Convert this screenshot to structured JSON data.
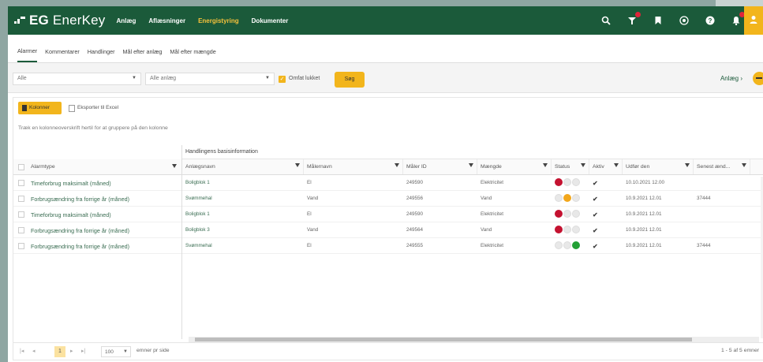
{
  "app": {
    "brand_mark": "EG",
    "brand_name": "EnerKey"
  },
  "nav": [
    {
      "label": "Anlæg",
      "active": false
    },
    {
      "label": "Aflæsninger",
      "active": false
    },
    {
      "label": "Energistyring",
      "active": true
    },
    {
      "label": "Dokumenter",
      "active": false
    }
  ],
  "top_icons": [
    "search-icon",
    "antenna-icon",
    "bookmark-icon",
    "plus-circle-icon",
    "help-icon",
    "bell-icon",
    "user-icon"
  ],
  "subtabs": [
    {
      "label": "Alarmer",
      "active": true
    },
    {
      "label": "Kommentarer",
      "active": false
    },
    {
      "label": "Handlinger",
      "active": false
    },
    {
      "label": "Mål efter anlæg",
      "active": false
    },
    {
      "label": "Mål efter mængde",
      "active": false
    }
  ],
  "filters": {
    "select1": "Alle",
    "select2": "Alle anlæg",
    "include_closed_label": "Omfat lukket",
    "include_closed": true,
    "search_label": "Søg",
    "anlaeg_link": "Anlæg"
  },
  "toolbar": {
    "columns_label": "Kolonner",
    "export_label": "Eksporter til Excel",
    "group_hint": "Træk en kolonneoverskrift hertil for at gruppere på den kolonne"
  },
  "grid": {
    "group_header": "Handlingens basisinformation",
    "left_column": "Alarmtype",
    "columns": [
      "Anlægsnavn",
      "Målernavn",
      "Måler ID",
      "Mængde",
      "Status",
      "Aktiv",
      "Udfør den",
      "Senest ænd..."
    ],
    "rows": [
      {
        "alarmtype": "Timeforbrug maksimalt (måned)",
        "anlaeg": "Boligblok 1",
        "maaler": "El",
        "maaler_id": "249590",
        "maengde": "Elektricitet",
        "status": "red",
        "aktiv": "✔",
        "udfoer": "10.10.2021 12.00",
        "senest": ""
      },
      {
        "alarmtype": "Forbrugsændring fra forrige år (måned)",
        "anlaeg": "Svømmehal",
        "maaler": "Vand",
        "maaler_id": "249556",
        "maengde": "Vand",
        "status": "orange",
        "aktiv": "✔",
        "udfoer": "10.9.2021 12.01",
        "senest": "37444"
      },
      {
        "alarmtype": "Timeforbrug maksimalt (måned)",
        "anlaeg": "Boligblok 1",
        "maaler": "El",
        "maaler_id": "249590",
        "maengde": "Elektricitet",
        "status": "red",
        "aktiv": "✔",
        "udfoer": "10.9.2021 12.01",
        "senest": ""
      },
      {
        "alarmtype": "Forbrugsændring fra forrige år (måned)",
        "anlaeg": "Boligblok 3",
        "maaler": "Vand",
        "maaler_id": "249564",
        "maengde": "Vand",
        "status": "red",
        "aktiv": "✔",
        "udfoer": "10.9.2021 12.01",
        "senest": ""
      },
      {
        "alarmtype": "Forbrugsændring fra forrige år (måned)",
        "anlaeg": "Svømmehal",
        "maaler": "El",
        "maaler_id": "249555",
        "maengde": "Elektricitet",
        "status": "green",
        "aktiv": "✔",
        "udfoer": "10.9.2021 12.01",
        "senest": "37444"
      }
    ]
  },
  "pager": {
    "current_page": "1",
    "page_size": "100",
    "page_size_label": "emner pr side",
    "info": "1 - 5 af 5 emner"
  },
  "colors": {
    "brand_green": "#1b5a3a",
    "accent_yellow": "#f2b51c",
    "status_red": "#c41230",
    "status_orange": "#f2a71c",
    "status_green": "#22a035"
  }
}
